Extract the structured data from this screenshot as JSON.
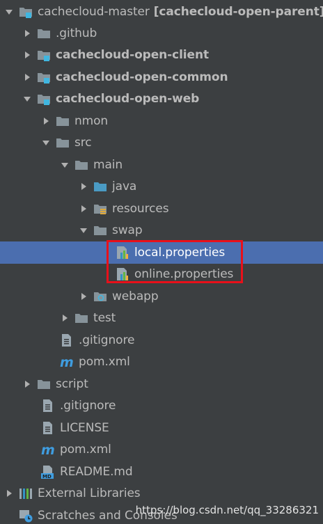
{
  "tree": {
    "root": {
      "name": "cachecloud-master",
      "module": "[cachecloud-open-parent]",
      "icon": "module-folder-icon"
    },
    "github": {
      "label": ".github",
      "icon": "folder-icon"
    },
    "client": {
      "label": "cachecloud-open-client",
      "icon": "module-folder-icon"
    },
    "common": {
      "label": "cachecloud-open-common",
      "icon": "module-folder-icon"
    },
    "web": {
      "label": "cachecloud-open-web",
      "icon": "module-folder-icon"
    },
    "nmon": {
      "label": "nmon",
      "icon": "folder-icon"
    },
    "src": {
      "label": "src",
      "icon": "folder-icon"
    },
    "main": {
      "label": "main",
      "icon": "folder-icon"
    },
    "java": {
      "label": "java",
      "icon": "source-folder-icon"
    },
    "resources": {
      "label": "resources",
      "icon": "resources-folder-icon"
    },
    "swap": {
      "label": "swap",
      "icon": "folder-icon"
    },
    "local_properties": {
      "label": "local.properties",
      "icon": "properties-file-icon"
    },
    "online_properties": {
      "label": "online.properties",
      "icon": "properties-file-icon"
    },
    "webapp": {
      "label": "webapp",
      "icon": "web-folder-icon"
    },
    "test": {
      "label": "test",
      "icon": "folder-icon"
    },
    "web_gitignore": {
      "label": ".gitignore",
      "icon": "text-file-icon"
    },
    "web_pom": {
      "label": "pom.xml",
      "icon": "maven-icon"
    },
    "script": {
      "label": "script",
      "icon": "folder-icon"
    },
    "gitignore": {
      "label": ".gitignore",
      "icon": "text-file-icon"
    },
    "license": {
      "label": "LICENSE",
      "icon": "text-file-icon"
    },
    "pom": {
      "label": "pom.xml",
      "icon": "maven-icon"
    },
    "readme": {
      "label": "README.md",
      "icon": "markdown-icon"
    },
    "external_libraries": {
      "label": "External Libraries",
      "icon": "libraries-icon"
    },
    "scratches": {
      "label": "Scratches and Consoles",
      "icon": "scratches-icon"
    }
  },
  "selected_item": "local.properties",
  "watermark": "https://blog.csdn.net/qq_33286321",
  "colors": {
    "background": "#3c3f41",
    "selection": "#4b6eaf",
    "text": "#bbbbbb",
    "highlight_box": "#e8101a",
    "folder": "#87939a",
    "source_folder": "#4a9bc4"
  }
}
